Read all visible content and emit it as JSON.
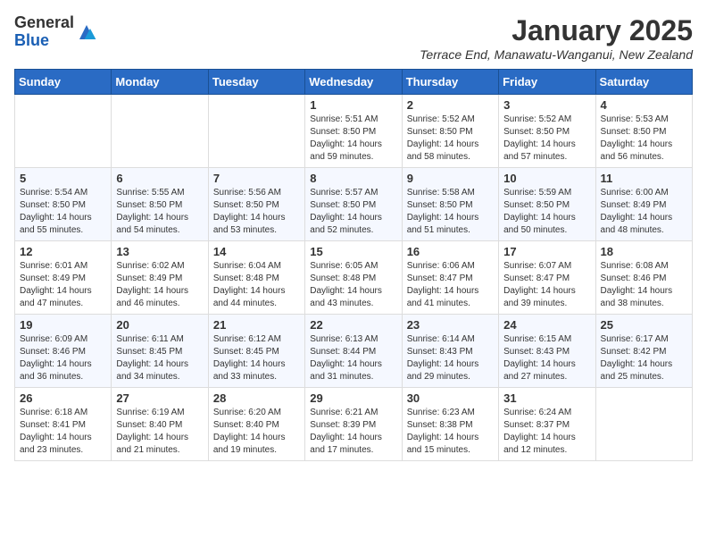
{
  "logo": {
    "general": "General",
    "blue": "Blue"
  },
  "title": "January 2025",
  "location": "Terrace End, Manawatu-Wanganui, New Zealand",
  "weekdays": [
    "Sunday",
    "Monday",
    "Tuesday",
    "Wednesday",
    "Thursday",
    "Friday",
    "Saturday"
  ],
  "weeks": [
    [
      {
        "day": "",
        "info": ""
      },
      {
        "day": "",
        "info": ""
      },
      {
        "day": "",
        "info": ""
      },
      {
        "day": "1",
        "info": "Sunrise: 5:51 AM\nSunset: 8:50 PM\nDaylight: 14 hours\nand 59 minutes."
      },
      {
        "day": "2",
        "info": "Sunrise: 5:52 AM\nSunset: 8:50 PM\nDaylight: 14 hours\nand 58 minutes."
      },
      {
        "day": "3",
        "info": "Sunrise: 5:52 AM\nSunset: 8:50 PM\nDaylight: 14 hours\nand 57 minutes."
      },
      {
        "day": "4",
        "info": "Sunrise: 5:53 AM\nSunset: 8:50 PM\nDaylight: 14 hours\nand 56 minutes."
      }
    ],
    [
      {
        "day": "5",
        "info": "Sunrise: 5:54 AM\nSunset: 8:50 PM\nDaylight: 14 hours\nand 55 minutes."
      },
      {
        "day": "6",
        "info": "Sunrise: 5:55 AM\nSunset: 8:50 PM\nDaylight: 14 hours\nand 54 minutes."
      },
      {
        "day": "7",
        "info": "Sunrise: 5:56 AM\nSunset: 8:50 PM\nDaylight: 14 hours\nand 53 minutes."
      },
      {
        "day": "8",
        "info": "Sunrise: 5:57 AM\nSunset: 8:50 PM\nDaylight: 14 hours\nand 52 minutes."
      },
      {
        "day": "9",
        "info": "Sunrise: 5:58 AM\nSunset: 8:50 PM\nDaylight: 14 hours\nand 51 minutes."
      },
      {
        "day": "10",
        "info": "Sunrise: 5:59 AM\nSunset: 8:50 PM\nDaylight: 14 hours\nand 50 minutes."
      },
      {
        "day": "11",
        "info": "Sunrise: 6:00 AM\nSunset: 8:49 PM\nDaylight: 14 hours\nand 48 minutes."
      }
    ],
    [
      {
        "day": "12",
        "info": "Sunrise: 6:01 AM\nSunset: 8:49 PM\nDaylight: 14 hours\nand 47 minutes."
      },
      {
        "day": "13",
        "info": "Sunrise: 6:02 AM\nSunset: 8:49 PM\nDaylight: 14 hours\nand 46 minutes."
      },
      {
        "day": "14",
        "info": "Sunrise: 6:04 AM\nSunset: 8:48 PM\nDaylight: 14 hours\nand 44 minutes."
      },
      {
        "day": "15",
        "info": "Sunrise: 6:05 AM\nSunset: 8:48 PM\nDaylight: 14 hours\nand 43 minutes."
      },
      {
        "day": "16",
        "info": "Sunrise: 6:06 AM\nSunset: 8:47 PM\nDaylight: 14 hours\nand 41 minutes."
      },
      {
        "day": "17",
        "info": "Sunrise: 6:07 AM\nSunset: 8:47 PM\nDaylight: 14 hours\nand 39 minutes."
      },
      {
        "day": "18",
        "info": "Sunrise: 6:08 AM\nSunset: 8:46 PM\nDaylight: 14 hours\nand 38 minutes."
      }
    ],
    [
      {
        "day": "19",
        "info": "Sunrise: 6:09 AM\nSunset: 8:46 PM\nDaylight: 14 hours\nand 36 minutes."
      },
      {
        "day": "20",
        "info": "Sunrise: 6:11 AM\nSunset: 8:45 PM\nDaylight: 14 hours\nand 34 minutes."
      },
      {
        "day": "21",
        "info": "Sunrise: 6:12 AM\nSunset: 8:45 PM\nDaylight: 14 hours\nand 33 minutes."
      },
      {
        "day": "22",
        "info": "Sunrise: 6:13 AM\nSunset: 8:44 PM\nDaylight: 14 hours\nand 31 minutes."
      },
      {
        "day": "23",
        "info": "Sunrise: 6:14 AM\nSunset: 8:43 PM\nDaylight: 14 hours\nand 29 minutes."
      },
      {
        "day": "24",
        "info": "Sunrise: 6:15 AM\nSunset: 8:43 PM\nDaylight: 14 hours\nand 27 minutes."
      },
      {
        "day": "25",
        "info": "Sunrise: 6:17 AM\nSunset: 8:42 PM\nDaylight: 14 hours\nand 25 minutes."
      }
    ],
    [
      {
        "day": "26",
        "info": "Sunrise: 6:18 AM\nSunset: 8:41 PM\nDaylight: 14 hours\nand 23 minutes."
      },
      {
        "day": "27",
        "info": "Sunrise: 6:19 AM\nSunset: 8:40 PM\nDaylight: 14 hours\nand 21 minutes."
      },
      {
        "day": "28",
        "info": "Sunrise: 6:20 AM\nSunset: 8:40 PM\nDaylight: 14 hours\nand 19 minutes."
      },
      {
        "day": "29",
        "info": "Sunrise: 6:21 AM\nSunset: 8:39 PM\nDaylight: 14 hours\nand 17 minutes."
      },
      {
        "day": "30",
        "info": "Sunrise: 6:23 AM\nSunset: 8:38 PM\nDaylight: 14 hours\nand 15 minutes."
      },
      {
        "day": "31",
        "info": "Sunrise: 6:24 AM\nSunset: 8:37 PM\nDaylight: 14 hours\nand 12 minutes."
      },
      {
        "day": "",
        "info": ""
      }
    ]
  ]
}
